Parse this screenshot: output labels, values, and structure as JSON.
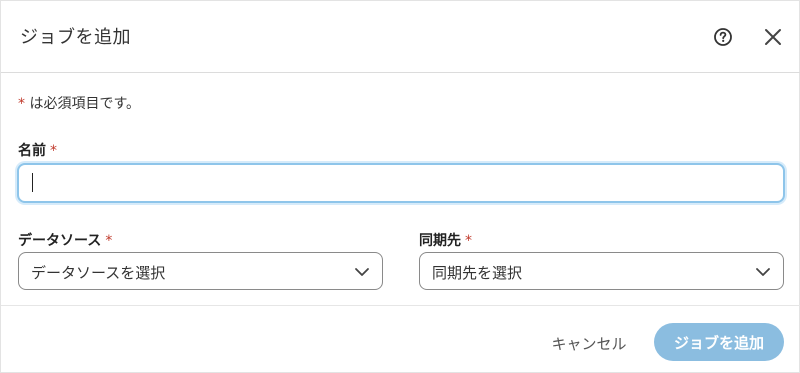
{
  "dialog": {
    "title": "ジョブを追加",
    "help_icon": "help-circle-icon",
    "close_icon": "close-icon"
  },
  "form": {
    "required_star": "*",
    "required_note": "は必須項目です。",
    "name": {
      "label": "名前",
      "value": ""
    },
    "data_source": {
      "label": "データソース",
      "placeholder": "データソースを選択"
    },
    "sync_destination": {
      "label": "同期先",
      "placeholder": "同期先を選択"
    }
  },
  "footer": {
    "cancel_label": "キャンセル",
    "submit_label": "ジョブを追加"
  },
  "colors": {
    "required": "#c0392b",
    "focus_border": "#8ec5ea",
    "primary_disabled": "#8bbde0"
  }
}
